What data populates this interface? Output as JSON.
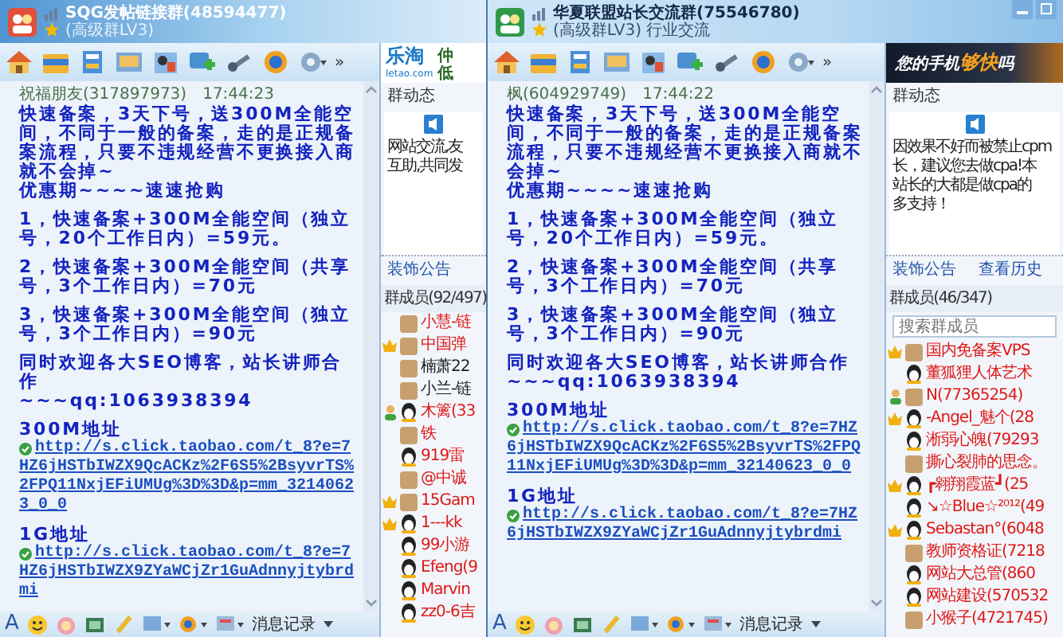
{
  "windows": [
    {
      "title": "SQG发帖链接群(48594477)",
      "subtitle": "(高级群LV3)",
      "controls": false,
      "toolbar_more": "»",
      "message": {
        "sender": "祝福朋友(317897973)",
        "time": "17:44:23",
        "blocks": [
          {
            "kind": "text",
            "text": "快速备案，3天下号，送300M全能空间，不同于一般的备案，走的是正规备案流程，只要不违规经营不更换接入商就不会掉~\n优惠期~~~~速速抢购"
          },
          {
            "kind": "text",
            "text": "1，快速备案+300M全能空间（独立号，20个工作日内）=59元。"
          },
          {
            "kind": "text",
            "text": "2，快速备案+300M全能空间（共享号，3个工作日内）=70元"
          },
          {
            "kind": "text",
            "text": "3，快速备案+300M全能空间（独立号，3个工作日内）=90元"
          },
          {
            "kind": "text",
            "text": "同时欢迎各大SEO博客，站长讲师合作\n~~~qq:1063938394"
          },
          {
            "kind": "heading",
            "text": "300M地址"
          },
          {
            "kind": "link",
            "text": "http://s.click.taobao.com/t_8?e=7HZ6jHSTbIWZX9QcACKz%2F6S5%2BsyvrTS%2FPQ11NxjEFiUMUg%3D%3D&p=mm_32140623_0_0"
          },
          {
            "kind": "heading",
            "text": "1G地址"
          },
          {
            "kind": "link",
            "text": "http://s.click.taobao.com/t_8?e=7HZ6jHSTbIWZX9ZYaWCjZr1GuAdnnyjtybrdmi"
          }
        ]
      },
      "font_button": "A",
      "history_button": "消息记录",
      "banner": {
        "kind": "logo",
        "items": [
          {
            "text": "乐淘",
            "kind": "logo"
          },
          {
            "text": "letao.com",
            "kind": "small"
          },
          {
            "text": "仲",
            "kind": "tag"
          },
          {
            "text": "低",
            "kind": "tag"
          }
        ]
      },
      "dynamics_label": "群动态",
      "notice_lines": [
        "网站交流,友",
        "互助,共同发"
      ],
      "links": [
        "装饰公告"
      ],
      "members_header": "群成员(92/497)",
      "members": [
        {
          "name": "小慧-链",
          "vip": true,
          "kind": "photo",
          "admin": false,
          "friend": false
        },
        {
          "name": "中国弹",
          "vip": true,
          "kind": "photo",
          "admin": true,
          "friend": false
        },
        {
          "name": "楠萧22",
          "vip": false,
          "kind": "photo",
          "admin": false,
          "friend": false
        },
        {
          "name": "小兰-链",
          "vip": false,
          "kind": "photo",
          "admin": false,
          "friend": false
        },
        {
          "name": "木篱(33",
          "vip": true,
          "kind": "penguin",
          "admin": false,
          "friend": true
        },
        {
          "name": "铁",
          "vip": true,
          "kind": "photo",
          "admin": false,
          "friend": false
        },
        {
          "name": "919雷",
          "vip": true,
          "kind": "penguin",
          "admin": false,
          "friend": false
        },
        {
          "name": "@中诚",
          "vip": true,
          "kind": "photo",
          "admin": false,
          "friend": false
        },
        {
          "name": "15Gam",
          "vip": true,
          "kind": "photo",
          "admin": true,
          "friend": false
        },
        {
          "name": "1---kk",
          "vip": true,
          "kind": "penguin",
          "admin": true,
          "friend": false
        },
        {
          "name": "99小游",
          "vip": true,
          "kind": "penguin",
          "admin": false,
          "friend": false
        },
        {
          "name": "Efeng(9",
          "vip": true,
          "kind": "penguin",
          "admin": false,
          "friend": false
        },
        {
          "name": "Marvin",
          "vip": true,
          "kind": "penguin",
          "admin": false,
          "friend": false
        },
        {
          "name": "zz0-6吉",
          "vip": true,
          "kind": "penguin",
          "admin": false,
          "friend": false
        }
      ]
    },
    {
      "title": "华夏联盟站长交流群(75546780)",
      "subtitle": "(高级群LV3) 行业交流",
      "controls": true,
      "toolbar_more": "»",
      "message": {
        "sender": "枫(604929749)",
        "time": "17:44:22",
        "blocks": [
          {
            "kind": "text",
            "text": "快速备案，3天下号，送300M全能空间，不同于一般的备案，走的是正规备案流程，只要不违规经营不更换接入商就不会掉~\n优惠期~~~~速速抢购"
          },
          {
            "kind": "text",
            "text": "1，快速备案+300M全能空间（独立号，20个工作日内）=59元。"
          },
          {
            "kind": "text",
            "text": "2，快速备案+300M全能空间（共享号，3个工作日内）=70元"
          },
          {
            "kind": "text",
            "text": "3，快速备案+300M全能空间（独立号，3个工作日内）=90元"
          },
          {
            "kind": "text",
            "text": "同时欢迎各大SEO博客，站长讲师合作\n~~~qq:1063938394"
          },
          {
            "kind": "heading",
            "text": "300M地址"
          },
          {
            "kind": "link",
            "text": "http://s.click.taobao.com/t_8?e=7HZ6jHSTbIWZX9QcACKz%2F6S5%2BsyvrTS%2FPQ11NxjEFiUMUg%3D%3D&p=mm_32140623_0_0"
          },
          {
            "kind": "heading",
            "text": "1G地址"
          },
          {
            "kind": "link",
            "text": "http://s.click.taobao.com/t_8?e=7HZ6jHSTbIWZX9ZYaWCjZr1GuAdnnyjtybrdmi"
          }
        ]
      },
      "font_button": "A",
      "history_button": "消息记录",
      "banner": {
        "kind": "ad",
        "items": [
          {
            "text": "您的手机",
            "kind": "ad"
          },
          {
            "text": "够快",
            "kind": "accent"
          },
          {
            "text": "吗",
            "kind": "ad"
          }
        ]
      },
      "dynamics_label": "群动态",
      "notice_lines": [
        "因效果不好而被禁止cpm",
        "长，建议您去做cpa!本",
        "站长的大都是做cpa的",
        "多支持！"
      ],
      "links": [
        "装饰公告",
        "查看历史"
      ],
      "members_header": "群成员(46/347)",
      "search": {
        "placeholder": "搜索群成员"
      },
      "members": [
        {
          "name": "国内免备案VPS",
          "vip": true,
          "kind": "photo",
          "admin": true,
          "friend": false
        },
        {
          "name": "董狐狸人体艺术",
          "vip": true,
          "kind": "penguin",
          "admin": false,
          "friend": false
        },
        {
          "name": "N(77365254)",
          "vip": true,
          "kind": "photo",
          "admin": false,
          "friend": true
        },
        {
          "name": "-Angel_魅个(28",
          "vip": true,
          "kind": "penguin",
          "admin": true,
          "friend": false
        },
        {
          "name": "淅弱心魄(79293",
          "vip": true,
          "kind": "penguin",
          "admin": false,
          "friend": false
        },
        {
          "name": "撕心裂肺的思念。",
          "vip": true,
          "kind": "photo",
          "admin": false,
          "friend": false
        },
        {
          "name": "┏翱翔霞蓝┛(25",
          "vip": true,
          "kind": "penguin",
          "admin": true,
          "friend": false
        },
        {
          "name": "↘☆Blue☆²⁰¹²(49",
          "vip": true,
          "kind": "penguin",
          "admin": false,
          "friend": false
        },
        {
          "name": "Sebastan°(6048",
          "vip": true,
          "kind": "penguin",
          "admin": true,
          "friend": false
        },
        {
          "name": "教师资格证(7218",
          "vip": true,
          "kind": "photo",
          "admin": false,
          "friend": false
        },
        {
          "name": "网站大总管(860",
          "vip": true,
          "kind": "penguin",
          "admin": false,
          "friend": false
        },
        {
          "name": "网站建设(570532",
          "vip": true,
          "kind": "penguin",
          "admin": false,
          "friend": false
        },
        {
          "name": "小猴子(4721745)",
          "vip": true,
          "kind": "photo",
          "admin": false,
          "friend": false
        }
      ]
    }
  ]
}
